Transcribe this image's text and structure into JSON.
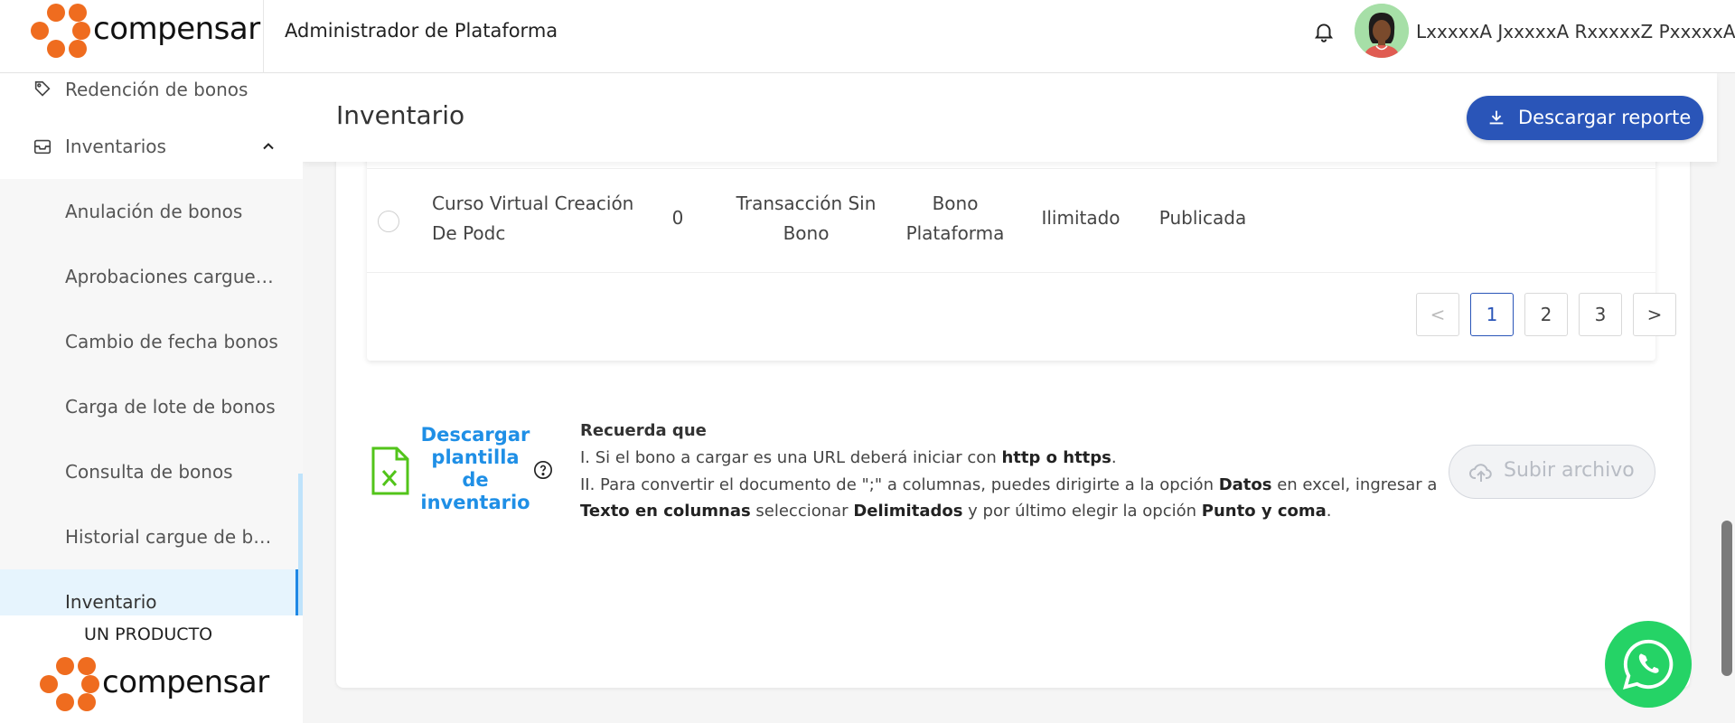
{
  "header": {
    "logo_text": "compensar",
    "app_title": "Administrador de Plataforma",
    "user_name": "LxxxxxA JxxxxxA RxxxxxZ PxxxxxA"
  },
  "sidebar": {
    "items": [
      {
        "label": "Redención de bonos",
        "icon": "tag-icon"
      },
      {
        "label": "Inventarios",
        "icon": "inbox-icon",
        "expanded": true
      }
    ],
    "subitems": [
      {
        "label": "Anulación de bonos"
      },
      {
        "label": "Aprobaciones cargue de bonos"
      },
      {
        "label": "Cambio de fecha bonos"
      },
      {
        "label": "Carga de lote de bonos"
      },
      {
        "label": "Consulta de bonos"
      },
      {
        "label": "Historial cargue de bonos"
      },
      {
        "label": "Inventario",
        "active": true
      }
    ],
    "footer_caption": "UN PRODUCTO",
    "footer_logo_text": "compensar"
  },
  "main": {
    "page_title": "Inventario",
    "report_button": "Descargar reporte",
    "table": {
      "rows": [
        {
          "name_line1": "Curso Virtual Creación",
          "name_line2": "De Podc",
          "quantity": "0",
          "type_line1": "Transacción Sin",
          "type_line2": "Bono",
          "category_line1": "Bono",
          "category_line2": "Plataforma",
          "stock": "Ilimitado",
          "status": "Publicada"
        }
      ],
      "pagination": {
        "prev": "<",
        "pages": [
          "1",
          "2",
          "3"
        ],
        "current": "1",
        "next": ">"
      }
    },
    "template": {
      "link_line1": "Descargar",
      "link_line2": "plantilla",
      "link_line3": "de",
      "link_line4": "inventario",
      "help_icon": "question-circle-icon"
    },
    "info": {
      "title": "Recuerda que",
      "line1_a": "I. Si el bono a cargar es una URL deberá iniciar con ",
      "line1_b": "http o https",
      "line1_c": ".",
      "line2_a": "II. Para convertir el documento de \";\" a columnas, puedes dirigirte a la opción ",
      "line2_b": "Datos",
      "line2_c": " en excel, ingresar a",
      "line3_a": "Texto en columnas",
      "line3_b": " seleccionar ",
      "line3_c": "Delimitados",
      "line3_d": " y por último elegir la opción ",
      "line3_e": "Punto y coma",
      "line3_f": "."
    },
    "upload_button": "Subir archivo"
  },
  "colors": {
    "brand_orange": "#ef6c1f",
    "primary_blue": "#2a55b8",
    "link_blue": "#1f8fe6",
    "excel_green": "#52c41a",
    "whatsapp_green": "#25d366"
  }
}
